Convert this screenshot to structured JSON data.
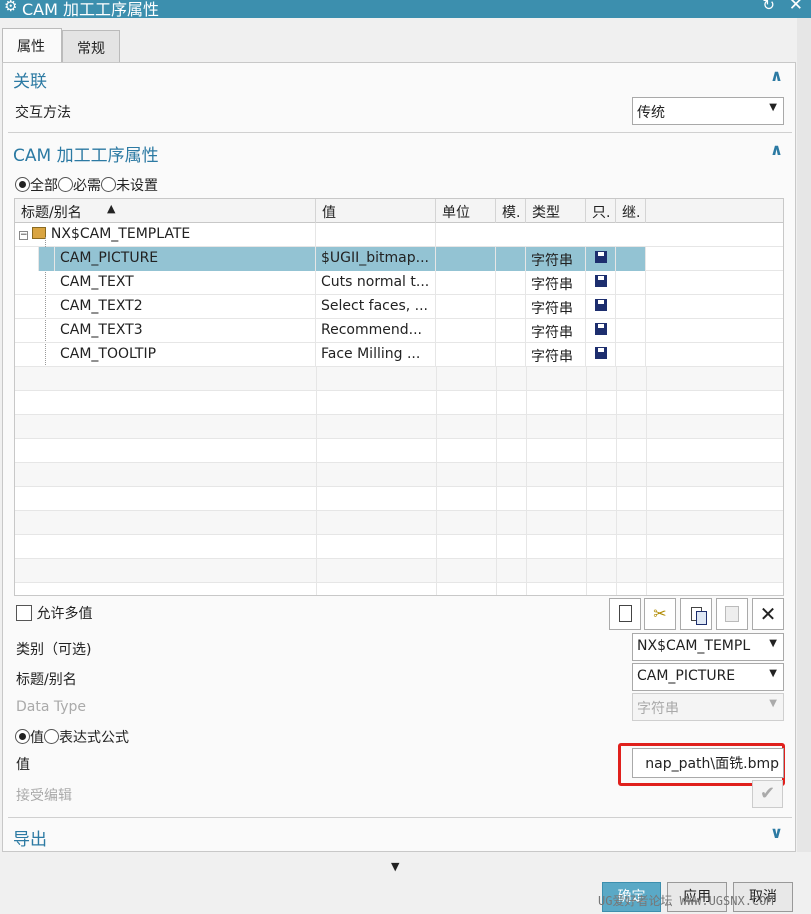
{
  "window": {
    "title": "CAM 加工工序属性",
    "gear_icon": "⚙",
    "restore_icon": "↻",
    "close_icon": "✕"
  },
  "tabs": [
    {
      "label": "属性"
    },
    {
      "label": "常规"
    }
  ],
  "assoc": {
    "title": "关联",
    "interaction_label": "交互方法",
    "interaction_value": "传统"
  },
  "props": {
    "title": "CAM 加工工序属性",
    "filters": [
      {
        "label": "全部"
      },
      {
        "label": "必需"
      },
      {
        "label": "未设置"
      }
    ],
    "columns": [
      "标题/别名",
      "值",
      "单位",
      "模.",
      "类型",
      "只.",
      "继."
    ],
    "sort_icon": "▲",
    "root": "NX$CAM_TEMPLATE",
    "rows": [
      {
        "name": "CAM_PICTURE",
        "value": "$UGII_bitmap...",
        "type": "字符串"
      },
      {
        "name": "CAM_TEXT",
        "value": "Cuts normal t...",
        "type": "字符串"
      },
      {
        "name": "CAM_TEXT2",
        "value": "Select faces, ...",
        "type": "字符串"
      },
      {
        "name": "CAM_TEXT3",
        "value": "Recommend...",
        "type": "字符串"
      },
      {
        "name": "CAM_TOOLTIP",
        "value": "Face Milling ...",
        "type": "字符串"
      }
    ]
  },
  "editor": {
    "allow_multi": "允许多值",
    "category_label": "类别（可选)",
    "category_value": "NX$CAM_TEMPL",
    "title_label": "标题/别名",
    "title_value": "CAM_PICTURE",
    "datatype_label": "Data Type",
    "datatype_value": "字符串",
    "mode_value": "值",
    "mode_expr": "表达式公式",
    "value_label": "值",
    "value": "nap_path\\面铣.bmp",
    "accept_label": "接受编辑"
  },
  "export": {
    "title": "导出"
  },
  "footer": {
    "ok": "确定",
    "apply": "应用",
    "cancel": "取消",
    "watermark": "UG爱好者论坛 WWW.UGSNX.COM"
  },
  "colors": {
    "accent": "#2c7aa3",
    "titlebar": "#3c8fae",
    "selection": "#93c3d3",
    "highlight_box": "#e0201c"
  }
}
